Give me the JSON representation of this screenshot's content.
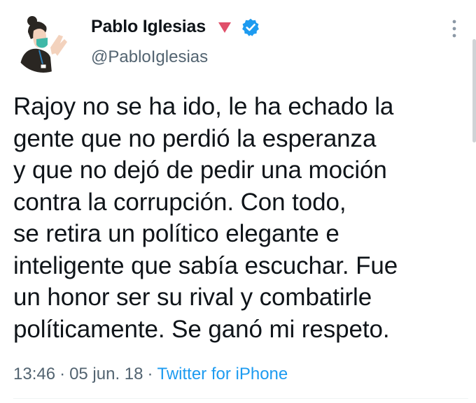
{
  "author": {
    "display_name": "Pablo Iglesias",
    "handle": "@PabloIglesias",
    "icons": [
      "avatar-illustration",
      "red-triangle-icon",
      "verified-badge-icon",
      "more-options-icon"
    ]
  },
  "tweet": {
    "lines": [
      "Rajoy no se ha ido, le ha echado la",
      "gente que no perdió la esperanza",
      "y que no dejó de pedir una moción",
      "contra la corrupción. Con todo,",
      "se retira un político elegante e",
      "inteligente que sabía escuchar. Fue",
      "un honor ser su rival y combatirle",
      "políticamente. Se ganó mi respeto."
    ],
    "time": "13:46",
    "date": "05 jun. 18",
    "separator": "·",
    "source": "Twitter for iPhone"
  },
  "colors": {
    "text": "#0f1419",
    "secondary": "#536471",
    "link": "#1d9bf0",
    "verified": "#1d9bf0",
    "triangle": "#e0506a"
  }
}
